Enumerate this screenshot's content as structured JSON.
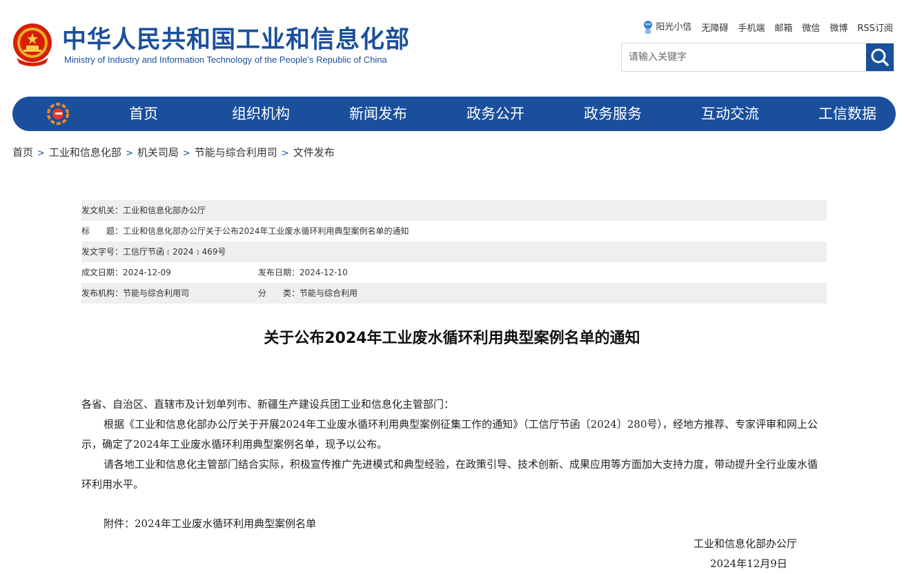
{
  "header": {
    "title_cn": "中华人民共和国工业和信息化部",
    "title_en": "Ministry of Industry and Information Technology of the People’s Republic of China",
    "links": [
      "阳光小信",
      "无障碍",
      "手机端",
      "邮箱",
      "微信",
      "微博",
      "RSS订阅"
    ],
    "search_placeholder": "请输入关键字"
  },
  "nav": {
    "items": [
      "首页",
      "组织机构",
      "新闻发布",
      "政务公开",
      "政务服务",
      "互动交流",
      "工信数据"
    ]
  },
  "breadcrumb": [
    "首页",
    "工业和信息化部",
    "机关司局",
    "节能与综合利用司",
    "文件发布"
  ],
  "meta": {
    "issuer": "发文机关：工业和信息化部办公厅",
    "title": "标　　题：工业和信息化部办公厅关于公布2024年工业废水循环利用典型案例名单的通知",
    "doc_no": "发文字号：工信厅节函﹝2024﹞469号",
    "created": "成文日期：2024-12-09",
    "published": "发布日期：2024-12-10",
    "org": "发布机构：节能与综合利用司",
    "category": "分　　类：节能与综合利用"
  },
  "article": {
    "title": "关于公布2024年工业废水循环利用典型案例名单的通知",
    "greeting": "各省、自治区、直辖市及计划单列市、新疆生产建设兵团工业和信息化主管部门：",
    "p1": "根据《工业和信息化部办公厅关于开展2024年工业废水循环利用典型案例征集工作的通知》（工信厅节函〔2024〕280号），经地方推荐、专家评审和网上公示，确定了2024年工业废水循环利用典型案例名单，现予以公布。",
    "p2": "请各地工业和信息化主管部门结合实际，积极宣传推广先进模式和典型经验，在政策引导、技术创新、成果应用等方面加大支持力度，带动提升全行业废水循环利用水平。",
    "attachment": "附件：2024年工业废水循环利用典型案例名单",
    "sign_org": "工业和信息化部办公厅",
    "sign_date": "2024年12月9日"
  },
  "colors": {
    "brand": "#1a4f9c",
    "meta_row": "#efefef"
  }
}
